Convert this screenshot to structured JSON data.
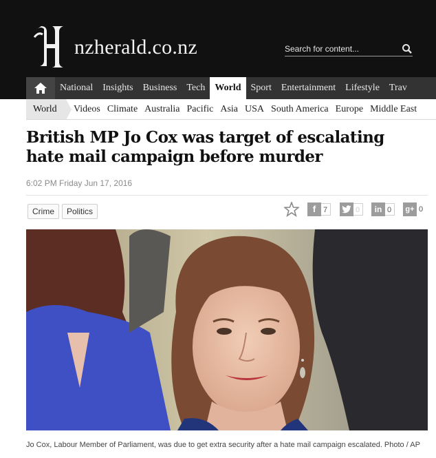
{
  "header": {
    "logo_text": "nzherald.co.nz",
    "search_placeholder": "Search for content..."
  },
  "main_nav": {
    "items": [
      "National",
      "Insights",
      "Business",
      "Tech",
      "World",
      "Sport",
      "Entertainment",
      "Lifestyle",
      "Trav"
    ],
    "active": "World"
  },
  "sub_nav": {
    "active": "World",
    "items": [
      "Videos",
      "Climate",
      "Australia",
      "Pacific",
      "Asia",
      "USA",
      "South America",
      "Europe",
      "Middle East"
    ]
  },
  "article": {
    "headline": "British MP Jo Cox was target of escalating hate mail campaign before murder",
    "dateline": "6:02 PM Friday Jun 17, 2016",
    "tags": [
      "Crime",
      "Politics"
    ],
    "caption": "Jo Cox, Labour Member of Parliament, was due to get extra security after a hate mail campaign escalated. Photo / AP"
  },
  "share": {
    "facebook_count": "7",
    "twitter_count": "0",
    "linkedin_count": "0",
    "googleplus_count": "0"
  },
  "colors": {
    "masthead": "#111111",
    "nav_bar": "#333333",
    "subnav_active": "#e6e6e6"
  }
}
